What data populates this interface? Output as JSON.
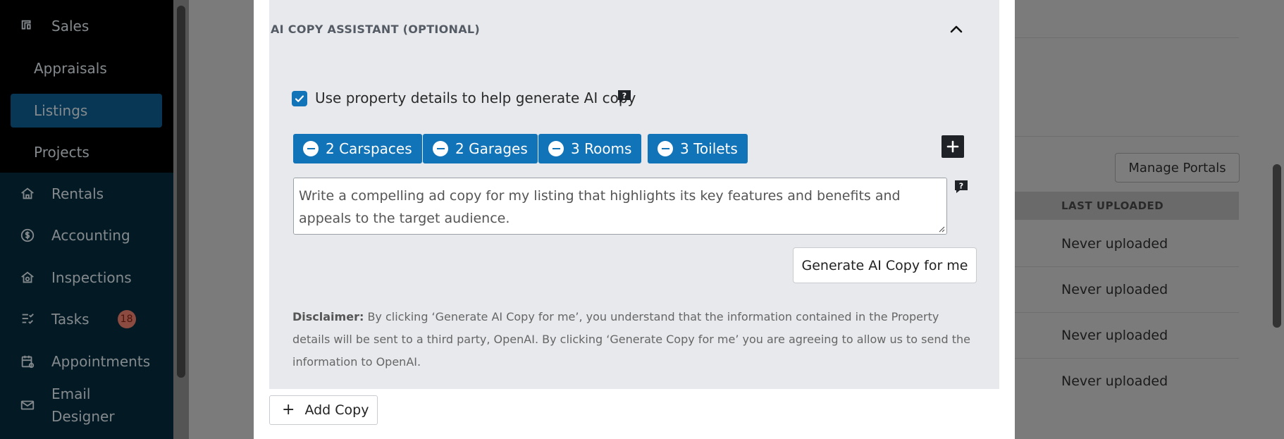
{
  "sidebar": {
    "sales": "Sales",
    "sub_items": [
      {
        "label": "Appraisals",
        "active": false
      },
      {
        "label": "Listings",
        "active": true
      },
      {
        "label": "Projects",
        "active": false
      }
    ],
    "rentals": "Rentals",
    "accounting": "Accounting",
    "inspections": "Inspections",
    "tasks": "Tasks",
    "tasks_badge": "18",
    "appointments": "Appointments",
    "email_designer_line1": "Email",
    "email_designer_line2": "Designer"
  },
  "background": {
    "manage_portals": "Manage Portals",
    "last_uploaded_header": "LAST UPLOADED",
    "rows": [
      "Never uploaded",
      "Never uploaded",
      "Never uploaded",
      "Never uploaded"
    ]
  },
  "modal": {
    "section_title": "AI COPY ASSISTANT (OPTIONAL)",
    "checkbox_label": "Use property details to help generate AI copy",
    "checkbox_checked": true,
    "chips": [
      "2 Carspaces",
      "2 Garages",
      "3 Rooms",
      "3 Toilets"
    ],
    "prompt_value": "Write a compelling ad copy for my listing that highlights its key features and benefits and appeals to the target audience.",
    "generate_button": "Generate AI Copy for me",
    "disclaimer_label": "Disclaimer:",
    "disclaimer_text": " By clicking ‘Generate AI Copy for me’, you understand that the information contained in the Property details will be sent to a third party, OpenAI. By clicking ‘Generate Copy for me’ you are agreeing to allow us to send the information to OpenAI.",
    "add_copy": "Add Copy"
  },
  "colors": {
    "accent": "#1173b8",
    "sidebar_bg": "#062a3a",
    "active_item": "#0d5a8a",
    "badge": "#e07a6a"
  }
}
